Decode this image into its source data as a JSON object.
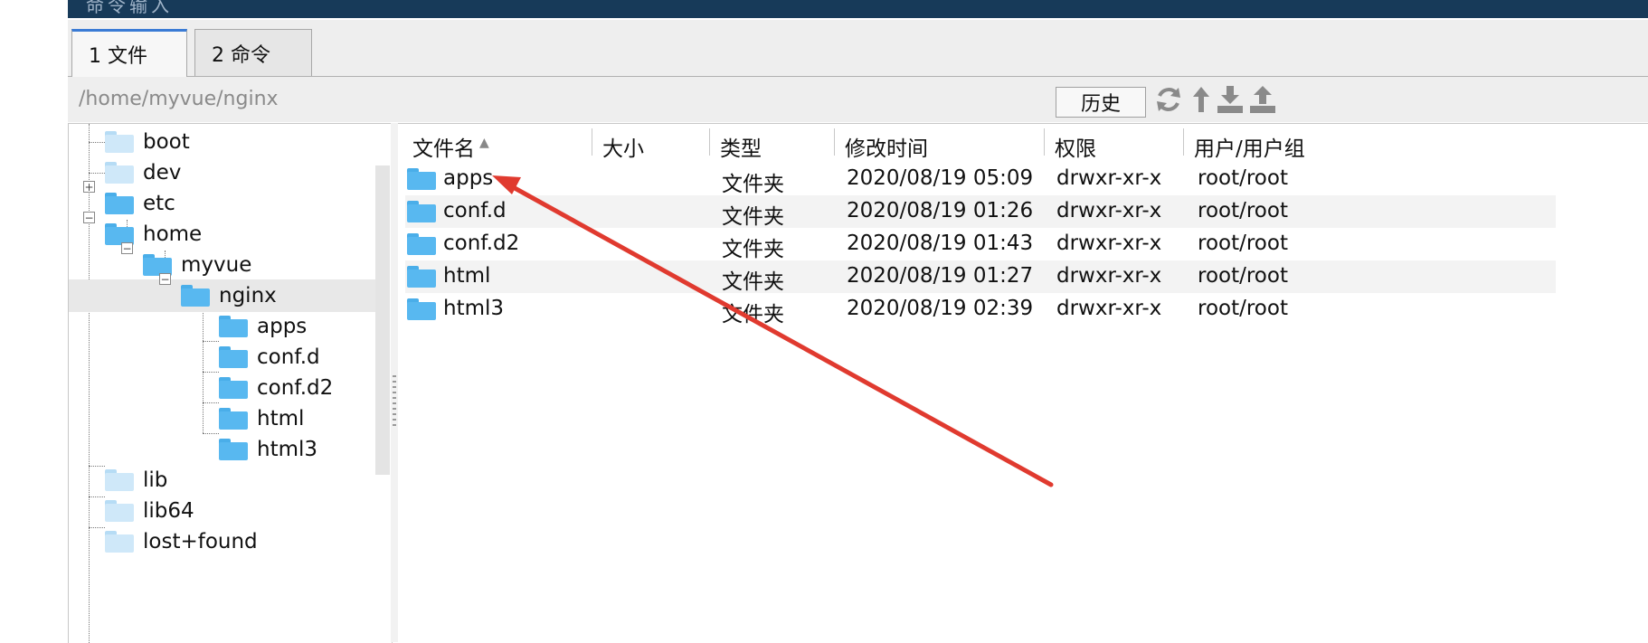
{
  "command_bar": {
    "label": "命令输入",
    "dots": "....."
  },
  "tabs": [
    {
      "label": "1 文件",
      "active": true
    },
    {
      "label": "2 命令",
      "active": false
    }
  ],
  "path_bar": {
    "path": "/home/myvue/nginx",
    "history_label": "历史",
    "tool_icons": [
      "refresh-icon",
      "up-arrow-icon",
      "download-icon",
      "upload-icon"
    ]
  },
  "tree": {
    "items": [
      {
        "label": "boot",
        "pale": true
      },
      {
        "label": "dev",
        "pale": true
      },
      {
        "label": "etc",
        "expander": "+"
      },
      {
        "label": "home",
        "expander": "−"
      },
      {
        "label": "myvue",
        "expander": "−"
      },
      {
        "label": "nginx",
        "expander": "−",
        "selected": true
      },
      {
        "label": "apps"
      },
      {
        "label": "conf.d"
      },
      {
        "label": "conf.d2"
      },
      {
        "label": "html"
      },
      {
        "label": "html3"
      },
      {
        "label": "lib",
        "pale": true
      },
      {
        "label": "lib64",
        "pale": true
      },
      {
        "label": "lost+found",
        "pale": true
      }
    ]
  },
  "file_list": {
    "columns": [
      "文件名",
      "大小",
      "类型",
      "修改时间",
      "权限",
      "用户/用户组"
    ],
    "sort_indicator": "▲",
    "rows": [
      {
        "name": "apps",
        "size": "",
        "type": "文件夹",
        "modified": "2020/08/19 05:09",
        "perms": "drwxr-xr-x",
        "owner": "root/root"
      },
      {
        "name": "conf.d",
        "size": "",
        "type": "文件夹",
        "modified": "2020/08/19 01:26",
        "perms": "drwxr-xr-x",
        "owner": "root/root"
      },
      {
        "name": "conf.d2",
        "size": "",
        "type": "文件夹",
        "modified": "2020/08/19 01:43",
        "perms": "drwxr-xr-x",
        "owner": "root/root"
      },
      {
        "name": "html",
        "size": "",
        "type": "文件夹",
        "modified": "2020/08/19 01:27",
        "perms": "drwxr-xr-x",
        "owner": "root/root"
      },
      {
        "name": "html3",
        "size": "",
        "type": "文件夹",
        "modified": "2020/08/19 02:39",
        "perms": "drwxr-xr-x",
        "owner": "root/root"
      }
    ]
  },
  "colors": {
    "command_bar": "#173a59",
    "folder": "#58b8f0",
    "active_tab_accent": "#3a7bd5",
    "annotation_arrow": "#e03a2f"
  }
}
